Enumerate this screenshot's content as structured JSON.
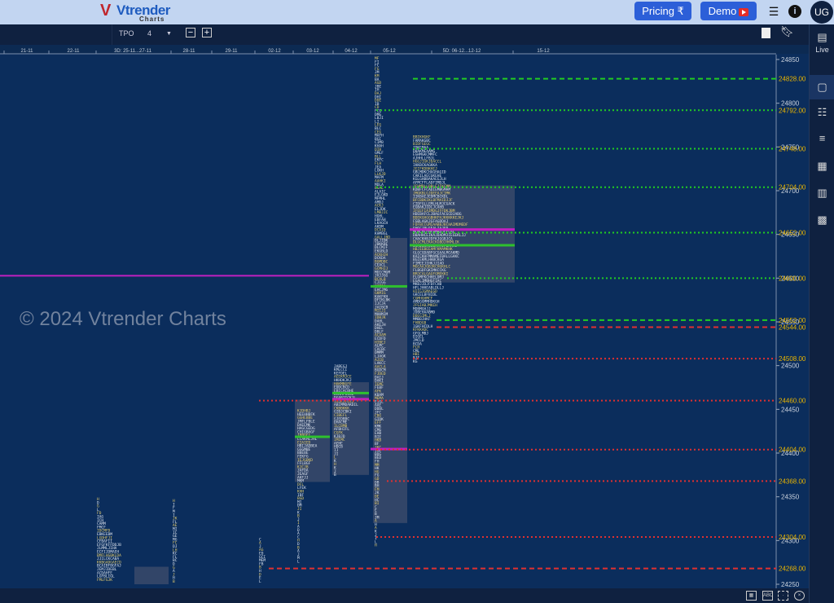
{
  "header": {
    "logo_text": "Vtrender",
    "logo_sub": "Charts",
    "pricing_label": "Pricing ₹",
    "demo_label": "Demo",
    "avatar": "UG"
  },
  "toolbar": {
    "mode_label": "TPO",
    "tpo_size": "4"
  },
  "sidebar": {
    "live_label": "Live",
    "items": [
      "live-icon",
      "single-layout-icon",
      "split-layout-icon",
      "rows-layout-icon",
      "grid-layout-icon",
      "columns-layout-icon",
      "grid6-layout-icon"
    ]
  },
  "watermark": "© 2024 Vtrender Charts",
  "date_axis": [
    "21-11",
    "22-11",
    "3D: 25-11...27-11",
    "28-11",
    "29-11",
    "02-12",
    "03-12",
    "04-12",
    "05-12",
    "5D: 06-12...12-12",
    "15-12"
  ],
  "price_axis": {
    "ticks": [
      "24850",
      "24800",
      "24750",
      "24700",
      "24650",
      "24600",
      "24550",
      "24500",
      "24450",
      "24400",
      "24350",
      "24300",
      "24250"
    ]
  },
  "levels": [
    {
      "price": "24828.00",
      "color": "#22cc22",
      "style": "dashed"
    },
    {
      "price": "24792.00",
      "color": "#22cc22",
      "style": "dotted"
    },
    {
      "price": "24748.00",
      "color": "#22cc22",
      "style": "dotted"
    },
    {
      "price": "24704.00",
      "color": "#22cc22",
      "style": "dotted"
    },
    {
      "price": "24652.00",
      "color": "#22cc22",
      "style": "dotted"
    },
    {
      "price": "24600.00",
      "color": "#22cc22",
      "style": "dotted"
    },
    {
      "price": "24552.00",
      "color": "#22cc22",
      "style": "dashed"
    },
    {
      "price": "24544.00",
      "color": "#e03030",
      "style": "dashed"
    },
    {
      "price": "24508.00",
      "color": "#e03030",
      "style": "dotted"
    },
    {
      "price": "24460.00",
      "color": "#e03030",
      "style": "dotted"
    },
    {
      "price": "24404.00",
      "color": "#e03030",
      "style": "dotted"
    },
    {
      "price": "24368.00",
      "color": "#e03030",
      "style": "dotted"
    },
    {
      "price": "24304.00",
      "color": "#e03030",
      "style": "dotted"
    },
    {
      "price": "24268.00",
      "color": "#e03030",
      "style": "dashed"
    }
  ],
  "level_label_color": "#e8b400",
  "vpoc_line_color": "#c020c0",
  "tpo_alphabet": "ABCDEFGHIJKLM"
}
